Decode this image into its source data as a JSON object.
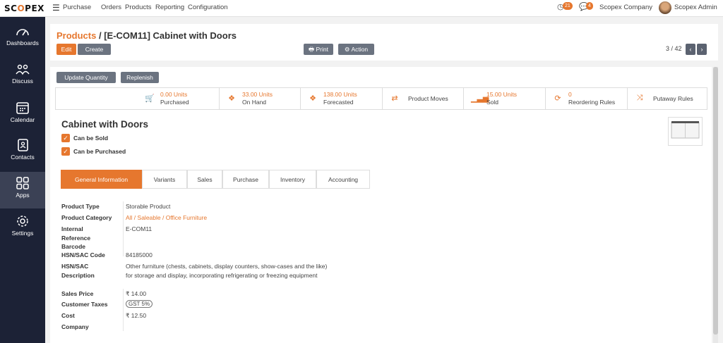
{
  "topbar": {
    "logo_a": "SC",
    "logo_o": "O",
    "logo_b": "PEX",
    "menu": [
      "Purchase",
      "Orders",
      "Products",
      "Reporting",
      "Configuration"
    ],
    "activity_count": "21",
    "message_count": "4",
    "company": "Scopex Company",
    "user": "Scopex Admin"
  },
  "sidebar": {
    "items": [
      {
        "label": "Dashboards",
        "icon": "gauge-icon"
      },
      {
        "label": "Discuss",
        "icon": "people-icon"
      },
      {
        "label": "Calendar",
        "icon": "calendar-icon"
      },
      {
        "label": "Contacts",
        "icon": "contact-book-icon"
      },
      {
        "label": "Apps",
        "icon": "grid-icon"
      },
      {
        "label": "Settings",
        "icon": "gear-icon"
      }
    ]
  },
  "header": {
    "breadcrumb_link": "Products",
    "separator": " / ",
    "record": "[E-COM11] Cabinet with Doors",
    "edit": "Edit",
    "create": "Create",
    "print": "Print",
    "action": "Action",
    "pager": "3 / 42"
  },
  "buttons": {
    "update_quantity": "Update Quantity",
    "replenish": "Replenish"
  },
  "stats": [
    {
      "value": "0.00 Units",
      "label": "Purchased"
    },
    {
      "value": "33.00 Units",
      "label": "On Hand"
    },
    {
      "value": "138.00 Units",
      "label": "Forecasted"
    },
    {
      "label": "Product Moves"
    },
    {
      "value": "15.00 Units",
      "label": "Sold"
    },
    {
      "value": "0",
      "label": "Reordering Rules"
    },
    {
      "label": "Putaway Rules"
    }
  ],
  "product": {
    "name": "Cabinet with Doors",
    "can_be_sold": "Can be Sold",
    "can_be_purchased": "Can be Purchased"
  },
  "tabs": [
    "General Information",
    "Variants",
    "Sales",
    "Purchase",
    "Inventory",
    "Accounting"
  ],
  "fields": {
    "product_type_label": "Product Type",
    "product_type": "Storable Product",
    "category_label": "Product Category",
    "category": "All / Saleable / Office Furniture",
    "internal_ref_label_1": "Internal",
    "internal_ref_label_2": "Reference",
    "internal_ref": "E-COM11",
    "barcode_label": "Barcode",
    "hsn_code_label": "HSN/SAC Code",
    "hsn_code": "84185000",
    "hsn_desc_label_1": "HSN/SAC",
    "hsn_desc_label_2": "Description",
    "hsn_desc_1": "Other furniture (chests, cabinets, display counters, show-cases and the like)",
    "hsn_desc_2": "for storage and display, incorporating refrigerating or freezing equipment",
    "sales_price_label": "Sales Price",
    "sales_price": "₹ 14.00",
    "taxes_label": "Customer Taxes",
    "tax": "GST 5%",
    "cost_label": "Cost",
    "cost": "₹ 12.50",
    "company_label": "Company"
  }
}
